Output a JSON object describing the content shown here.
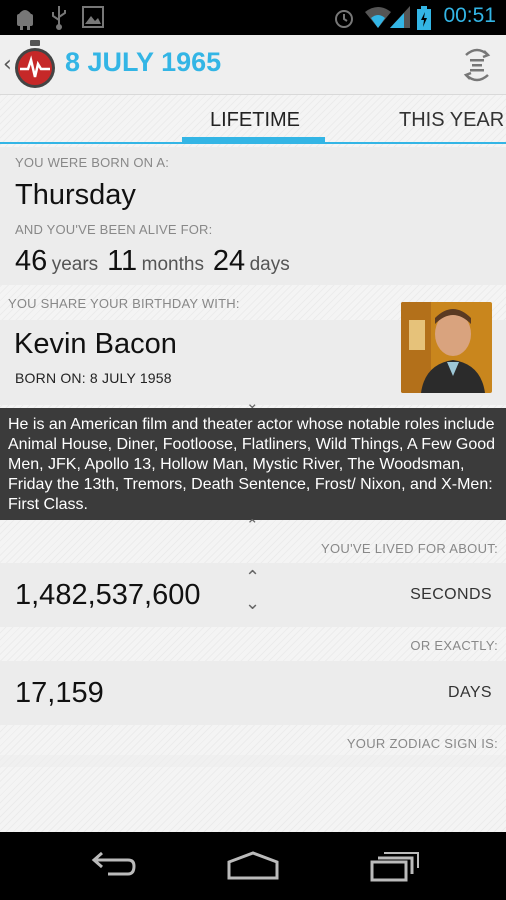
{
  "status_bar": {
    "time": "00:51"
  },
  "action_bar": {
    "title": "8 JULY 1965"
  },
  "tabs": [
    {
      "label": "LIFETIME"
    },
    {
      "label": "THIS YEAR"
    }
  ],
  "born": {
    "label": "YOU WERE BORN ON A:",
    "weekday": "Thursday"
  },
  "alive": {
    "label": "AND YOU'VE BEEN ALIVE FOR:",
    "years_value": "46",
    "years_unit": "years",
    "months_value": "11",
    "months_unit": "months",
    "days_value": "24",
    "days_unit": "days"
  },
  "share": {
    "label": "YOU SHARE YOUR BIRTHDAY WITH:",
    "name": "Kevin Bacon",
    "born_on": "BORN ON: 8 JULY 1958",
    "bio": "He is an American film and theater actor whose notable roles include Animal House, Diner, Footloose, Flatliners, Wild Things, A Few Good Men, JFK, Apollo 13, Hollow Man, Mystic River, The Woodsman, Friday the 13th, Tremors, Death Sentence, Frost/ Nixon, and X-Men: First Class."
  },
  "lived": {
    "label": "YOU'VE LIVED FOR ABOUT:",
    "value": "1,482,537,600",
    "unit": "SECONDS"
  },
  "exactly": {
    "label": "OR EXACTLY:",
    "value": "17,159",
    "unit": "DAYS"
  },
  "zodiac": {
    "label": "YOUR ZODIAC SIGN IS:"
  },
  "colors": {
    "accent": "#33b5e5",
    "bio_bg": "#3b3b3b"
  }
}
